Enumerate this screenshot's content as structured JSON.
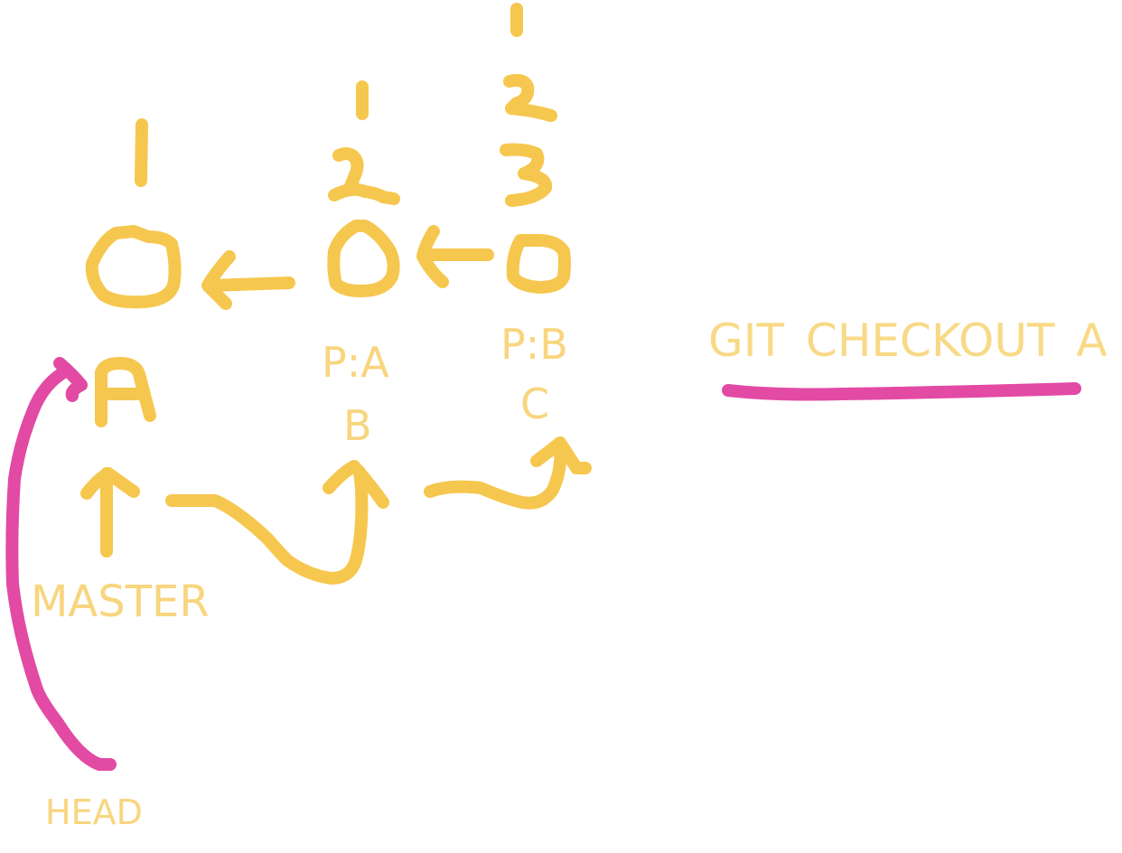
{
  "nodes": [
    {
      "id": "A",
      "letter": "A",
      "line_count": "1"
    },
    {
      "id": "B",
      "letter": "B",
      "line_count": "2",
      "parent": "P:A"
    },
    {
      "id": "C",
      "letter": "C",
      "line_count": "3",
      "parent": "P:B"
    }
  ],
  "labels": {
    "master": "MASTER",
    "head": "HEAD",
    "command": "GIT CHECKOUT A"
  },
  "colors": {
    "commit_ink": "#f6c74e",
    "head_ink": "#e24aa4",
    "text_ink": "#f8d57e"
  }
}
